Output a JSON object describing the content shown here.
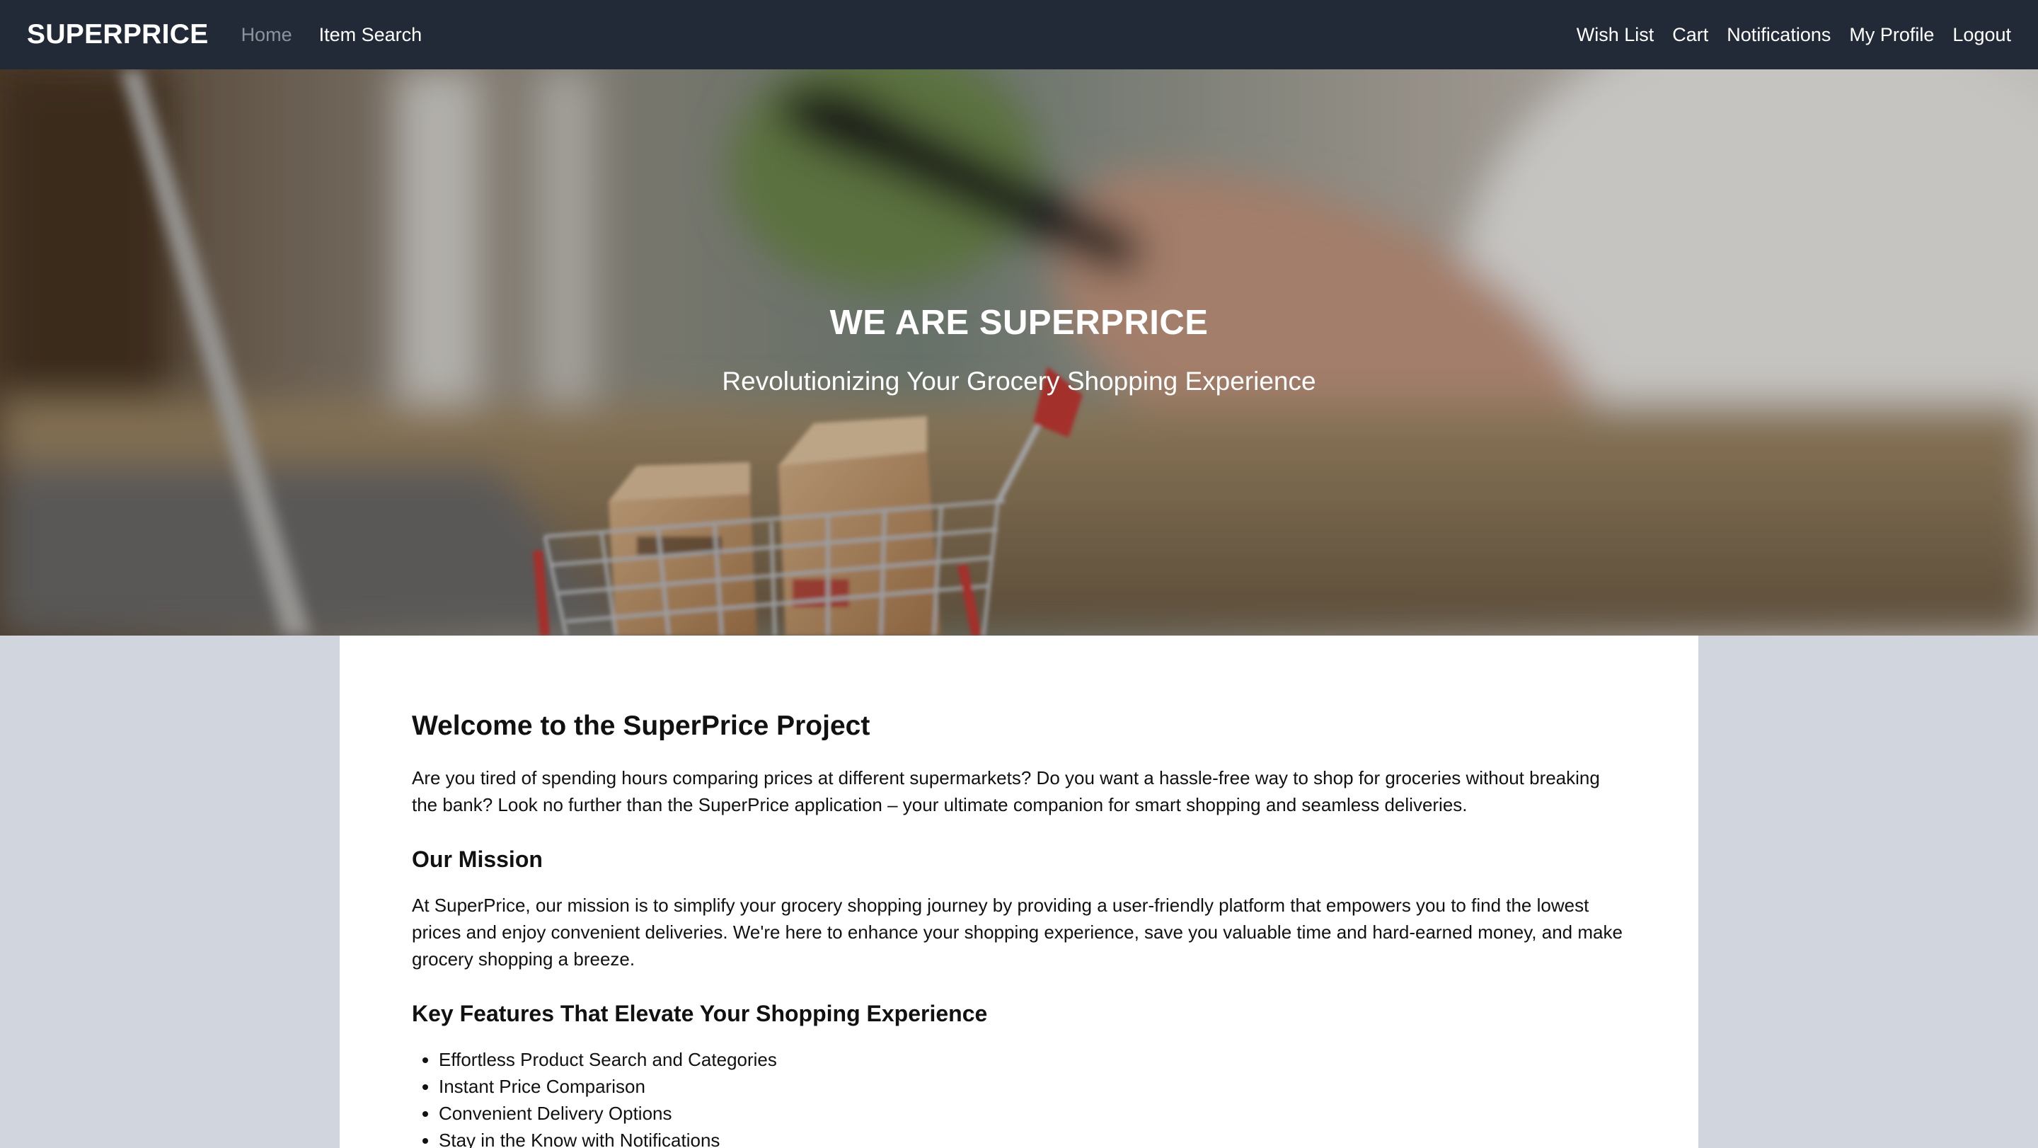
{
  "navbar": {
    "brand": "SUPERPRICE",
    "left_links": [
      "Home",
      "Item Search"
    ],
    "right_links": [
      "Wish List",
      "Cart",
      "Notifications",
      "My Profile",
      "Logout"
    ],
    "background_color": "#222a37"
  },
  "hero": {
    "title": "WE ARE SUPERPRICE",
    "subtitle": "Revolutionizing Your Grocery Shopping Experience",
    "image_subject": "shopping-cart-with-boxes-and-phone-photo"
  },
  "main": {
    "heading": "Welcome to the SuperPrice Project",
    "intro": "Are you tired of spending hours comparing prices at different supermarkets? Do you want a hassle-free way to shop for groceries without breaking the bank? Look no further than the SuperPrice application – your ultimate companion for smart shopping and seamless deliveries.",
    "mission_heading": "Our Mission",
    "mission_text": "At SuperPrice, our mission is to simplify your grocery shopping journey by providing a user-friendly platform that empowers you to find the lowest prices and enjoy convenient deliveries. We're here to enhance your shopping experience, save you valuable time and hard-earned money, and make grocery shopping a breeze.",
    "features_heading": "Key Features That Elevate Your Shopping Experience",
    "features": [
      "Effortless Product Search and Categories",
      "Instant Price Comparison",
      "Convenient Delivery Options",
      "Stay in the Know with Notifications"
    ]
  },
  "colors": {
    "page_background": "#d1d5de",
    "card_background": "#ffffff",
    "muted_link": "#8d939c"
  }
}
